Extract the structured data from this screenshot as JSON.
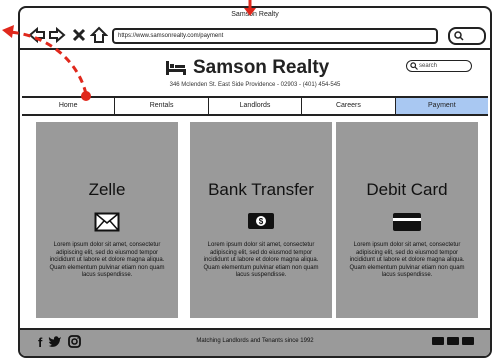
{
  "browser": {
    "title": "Samson Realty",
    "url": "https://www.samsonrealty.com/payment"
  },
  "site": {
    "name": "Samson Realty",
    "address": "346 Mclenden St. East Side Providence - 02903 - (401) 454-545",
    "search_placeholder": "search"
  },
  "nav": {
    "tabs": [
      "Home",
      "Rentals",
      "Landlords",
      "Careers",
      "Payment"
    ],
    "active": "Payment"
  },
  "cards": [
    {
      "title": "Zelle",
      "icon": "envelope-icon",
      "text": "Lorem ipsum dolor sit amet, consectetur adipiscing elit, sed do eiusmod tempor incididunt ut labore et dolore magna aliqua. Quam elementum pulvinar etiam non quam lacus suspendisse."
    },
    {
      "title": "Bank Transfer",
      "icon": "banknote-icon",
      "text": "Lorem ipsum dolor sit amet, consectetur adipiscing elit, sed do eiusmod tempor incididunt ut labore et dolore magna aliqua. Quam elementum pulvinar etiam non quam lacus suspendisse."
    },
    {
      "title": "Debit Card",
      "icon": "credit-card-icon",
      "text": "Lorem ipsum dolor sit amet, consectetur adipiscing elit, sed do eiusmod tempor incididunt ut labore et dolore magna aliqua. Quam elementum pulvinar etiam non quam lacus suspendisse."
    }
  ],
  "footer": {
    "social": [
      "f",
      "twitter",
      "instagram"
    ],
    "tagline": "Matching Landlords and Tenants since 1992"
  },
  "colors": {
    "card_bg": "#9a9a9a",
    "active_tab": "#a9c8f2",
    "annotation": "#e0281c"
  }
}
